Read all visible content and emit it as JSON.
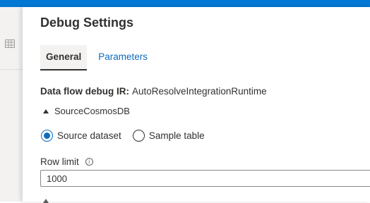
{
  "panel": {
    "title": "Debug Settings"
  },
  "tabs": [
    {
      "label": "General",
      "active": true
    },
    {
      "label": "Parameters",
      "active": false
    }
  ],
  "debug_ir": {
    "label": "Data flow debug IR:",
    "value": "AutoResolveIntegrationRuntime"
  },
  "source": {
    "name": "SourceCosmosDB",
    "expanded": true
  },
  "source_type": {
    "options": [
      {
        "label": "Source dataset",
        "selected": true
      },
      {
        "label": "Sample table",
        "selected": false
      }
    ]
  },
  "row_limit": {
    "label": "Row limit",
    "value": "1000"
  },
  "colors": {
    "accent": "#0078d4",
    "link": "#0f6cbd",
    "text": "#323130"
  },
  "icons": {
    "backdrop": "grid-icon",
    "expand": "caret-up-icon",
    "info": "info-icon"
  }
}
